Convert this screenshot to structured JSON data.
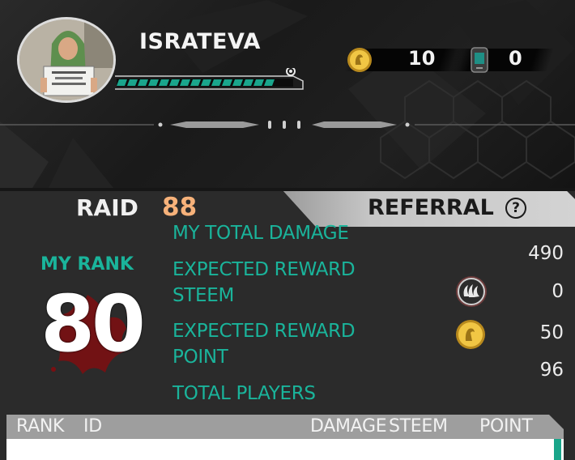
{
  "player": {
    "name": "ISRATEVA",
    "xp_progress": 0.92
  },
  "currencies": [
    {
      "icon": "gold-coin-icon",
      "value": "10"
    },
    {
      "icon": "phone-device-icon",
      "value": "0"
    }
  ],
  "tabs": {
    "raid_label": "RAID",
    "raid_value": "88",
    "referral_label": "REFERRAL",
    "help_symbol": "?"
  },
  "rank": {
    "label": "MY RANK",
    "value": "80"
  },
  "stats": {
    "total_damage_label": "MY TOTAL DAMAGE",
    "total_damage_value": "490",
    "reward_steem_label_1": "EXPECTED REWARD",
    "reward_steem_label_2": "STEEM",
    "reward_steem_value": "0",
    "reward_point_label_1": "EXPECTED REWARD",
    "reward_point_label_2": "POINT",
    "reward_point_value": "50",
    "total_players_label": "TOTAL PLAYERS",
    "total_players_value": "96"
  },
  "table": {
    "columns": [
      "RANK",
      "ID",
      "DAMAGE",
      "STEEM",
      "POINT"
    ]
  },
  "colors": {
    "teal": "#1ab49b",
    "orange": "#f7b27a",
    "panel": "#2b2b2b"
  }
}
